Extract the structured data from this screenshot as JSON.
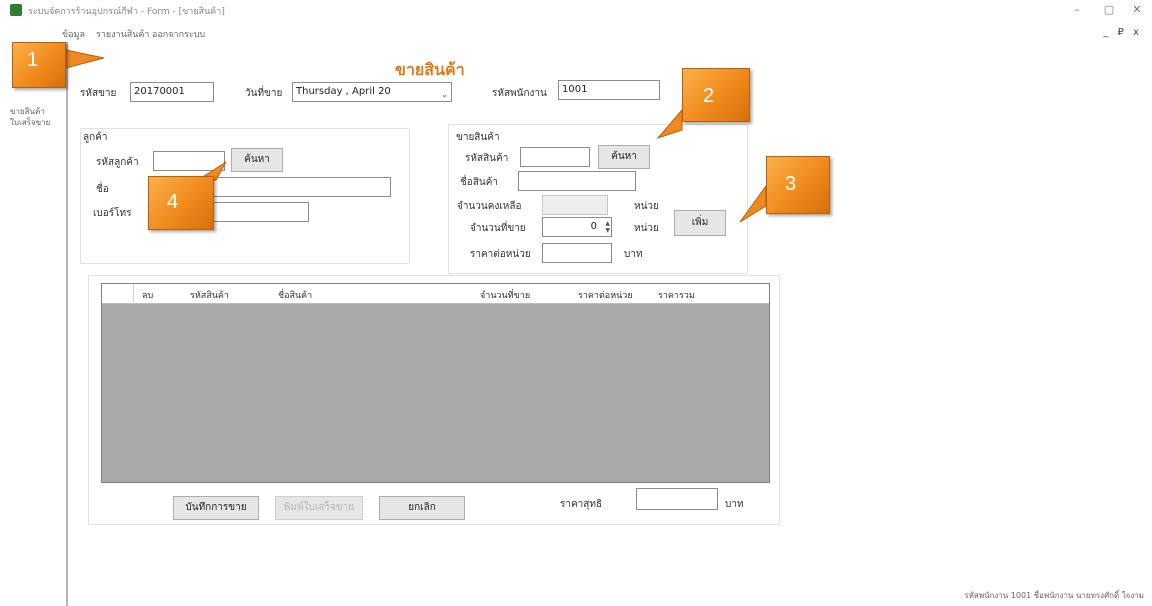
{
  "window": {
    "title": "ระบบจัดการร้านอุปกรณ์กีฬา - Form - [ขายสินค้า]",
    "menu": [
      "ข้อมูล",
      "รายงานสินค้า",
      "ออกจากระบบ"
    ],
    "minimize": "–",
    "maximize": "▢",
    "close": "✕",
    "mdi_controls": "_ ₽ x"
  },
  "sidebar": {
    "items": [
      "ขายสินค้า",
      "ใบเสร็จขาย"
    ]
  },
  "form": {
    "title": "ขายสินค้า",
    "sale_no_label": "รหัสขาย",
    "sale_no": "20170001",
    "date_label": "วันที่ขาย",
    "date_value": "Thursday ,   April   20",
    "employee_label": "รหัสพนักงาน",
    "employee_id": "1001"
  },
  "customer": {
    "group_label": "ลูกค้า",
    "id_label": "รหัสลูกค้า",
    "id_value": "",
    "search_button": "ค้นหา",
    "name_label": "ชื่อ",
    "name_value": "",
    "phone_label": "เบอร์โทร",
    "phone_value": ""
  },
  "product": {
    "group_label": "ขายสินค้า",
    "id_label": "รหัสสินค้า",
    "id_value": "",
    "search_button": "ค้นหา",
    "name_label": "ชื่อสินค้า",
    "name_value": "",
    "stock_label": "จำนวนคงเหลือ",
    "stock_value": "",
    "stock_unit": "หน่วย",
    "qty_label": "จำนวนที่ขาย",
    "qty_value": "0",
    "qty_unit": "หน่วย",
    "price_label": "ราคาต่อหน่วย",
    "price_value": "",
    "price_unit": "บาท",
    "add_button": "เพิ่ม"
  },
  "grid": {
    "columns": [
      "ลบ",
      "รหัสสินค้า",
      "ชื่อสินค้า",
      "จำนวนที่ขาย",
      "ราคาต่อหน่วย",
      "ราคารวม"
    ]
  },
  "footer": {
    "save_button": "บันทึกการขาย",
    "print_button": "พิมพ์ใบเสร็จขาย",
    "cancel_button": "ยกเลิก",
    "total_label": "ราคาสุทธิ",
    "total_value": "",
    "total_unit": "บาท"
  },
  "callouts": [
    "1",
    "2",
    "3",
    "4"
  ],
  "statusbar": {
    "text": "รหัสพนักงาน 1001  ชื่อพนักงาน นายทรงศักดิ์ ใจงาม"
  },
  "colors": {
    "title_orange": "#e07b16",
    "callout_orange": "#f08a1c",
    "grid_background": "#a9a9a9"
  }
}
